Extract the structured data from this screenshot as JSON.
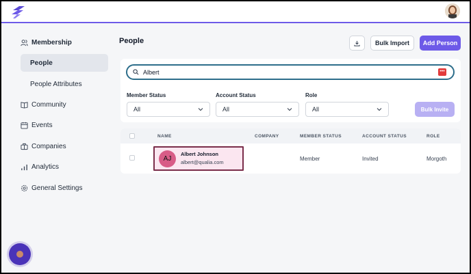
{
  "header": {
    "logo": "logo-icon",
    "avatar": "user-avatar"
  },
  "sidebar": {
    "items": [
      {
        "label": "Membership",
        "icon": "users-icon"
      },
      {
        "label": "People",
        "active": true
      },
      {
        "label": "People Attributes"
      },
      {
        "label": "Community",
        "icon": "book-icon"
      },
      {
        "label": "Events",
        "icon": "calendar-icon"
      },
      {
        "label": "Companies",
        "icon": "briefcase-icon"
      },
      {
        "label": "Analytics",
        "icon": "bar-chart-icon"
      },
      {
        "label": "General Settings",
        "icon": "gear-icon"
      }
    ]
  },
  "main": {
    "title": "People",
    "download_icon": "download-icon",
    "bulk_import_label": "Bulk Import",
    "add_person_label": "Add Person",
    "search": {
      "value": "Albert",
      "badge": "•••"
    },
    "filters": [
      {
        "label": "Member Status",
        "value": "All"
      },
      {
        "label": "Account Status",
        "value": "All"
      },
      {
        "label": "Role",
        "value": "All"
      }
    ],
    "bulk_invite_label": "Bulk Invite"
  },
  "table": {
    "headers": [
      "NAME",
      "COMPANY",
      "MEMBER STATUS",
      "ACCOUNT STATUS",
      "ROLE"
    ],
    "rows": [
      {
        "initials": "AJ",
        "name": "Albert Johnson",
        "email": "albert@qualia.com",
        "company": "",
        "member_status": "Member",
        "account_status": "Invited",
        "role": "Morgoth"
      }
    ]
  },
  "colors": {
    "accent": "#6d5ae8",
    "active_nav": "#e3e6ec",
    "avatar_bg": "#d85c87",
    "highlight_border": "#7a2d4a"
  }
}
